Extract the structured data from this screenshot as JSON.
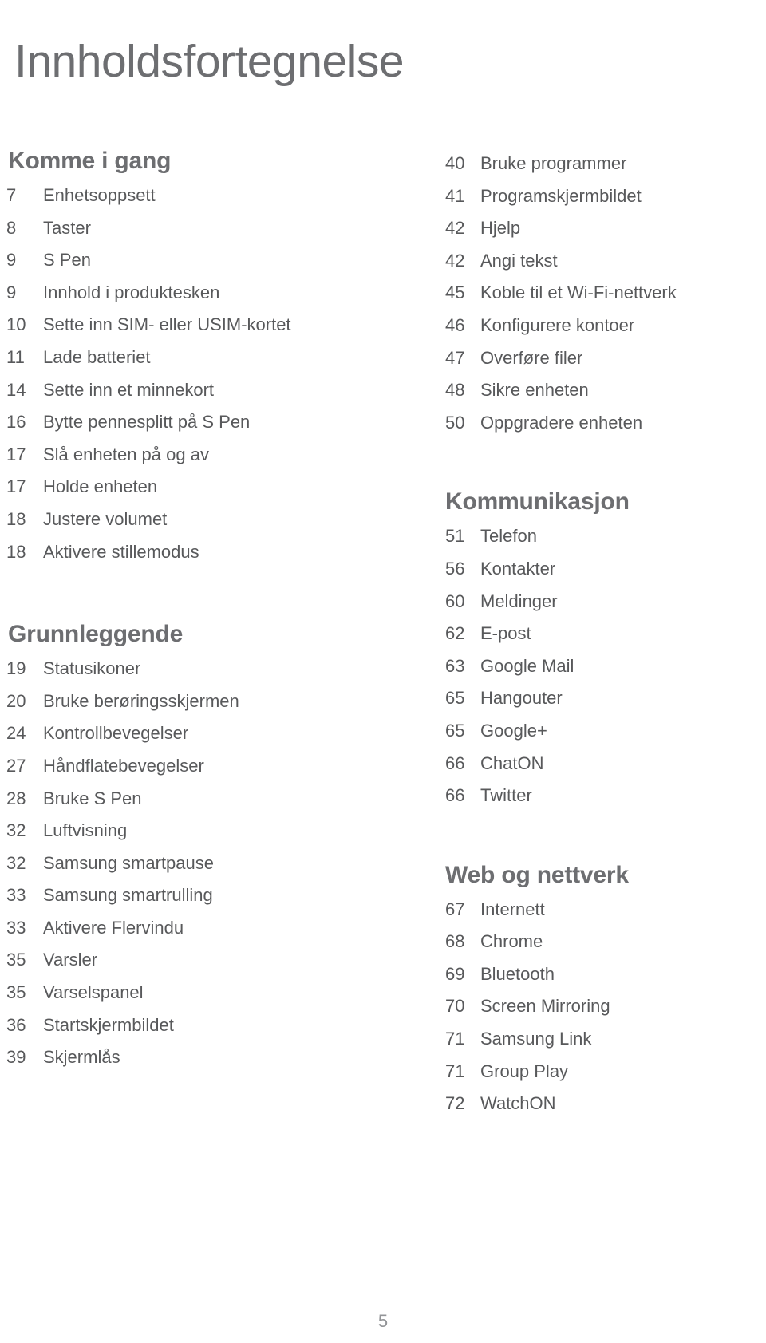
{
  "document": {
    "title": "Innholdsfortegnelse",
    "page_number": "5"
  },
  "left_column": {
    "sections": [
      {
        "title": "Komme i gang",
        "entries": [
          {
            "page": "7",
            "label": "Enhetsoppsett"
          },
          {
            "page": "8",
            "label": "Taster"
          },
          {
            "page": "9",
            "label": "S Pen"
          },
          {
            "page": "9",
            "label": "Innhold i produktesken"
          },
          {
            "page": "10",
            "label": "Sette inn SIM- eller USIM-kortet"
          },
          {
            "page": "11",
            "label": "Lade batteriet"
          },
          {
            "page": "14",
            "label": "Sette inn et minnekort"
          },
          {
            "page": "16",
            "label": "Bytte pennesplitt på S Pen"
          },
          {
            "page": "17",
            "label": "Slå enheten på og av"
          },
          {
            "page": "17",
            "label": "Holde enheten"
          },
          {
            "page": "18",
            "label": "Justere volumet"
          },
          {
            "page": "18",
            "label": "Aktivere stillemodus"
          }
        ]
      },
      {
        "title": "Grunnleggende",
        "entries": [
          {
            "page": "19",
            "label": "Statusikoner"
          },
          {
            "page": "20",
            "label": "Bruke berøringsskjermen"
          },
          {
            "page": "24",
            "label": "Kontrollbevegelser"
          },
          {
            "page": "27",
            "label": "Håndflatebevegelser"
          },
          {
            "page": "28",
            "label": "Bruke S Pen"
          },
          {
            "page": "32",
            "label": "Luftvisning"
          },
          {
            "page": "32",
            "label": "Samsung smartpause"
          },
          {
            "page": "33",
            "label": "Samsung smartrulling"
          },
          {
            "page": "33",
            "label": "Aktivere Flervindu"
          },
          {
            "page": "35",
            "label": "Varsler"
          },
          {
            "page": "35",
            "label": "Varselspanel"
          },
          {
            "page": "36",
            "label": "Startskjermbildet"
          },
          {
            "page": "39",
            "label": "Skjermlås"
          }
        ]
      }
    ]
  },
  "right_column": {
    "sections": [
      {
        "title": "",
        "entries": [
          {
            "page": "40",
            "label": "Bruke programmer"
          },
          {
            "page": "41",
            "label": "Programskjermbildet"
          },
          {
            "page": "42",
            "label": "Hjelp"
          },
          {
            "page": "42",
            "label": "Angi tekst"
          },
          {
            "page": "45",
            "label": "Koble til et Wi-Fi-nettverk"
          },
          {
            "page": "46",
            "label": "Konfigurere kontoer"
          },
          {
            "page": "47",
            "label": "Overføre filer"
          },
          {
            "page": "48",
            "label": "Sikre enheten"
          },
          {
            "page": "50",
            "label": "Oppgradere enheten"
          }
        ]
      },
      {
        "title": "Kommunikasjon",
        "entries": [
          {
            "page": "51",
            "label": "Telefon"
          },
          {
            "page": "56",
            "label": "Kontakter"
          },
          {
            "page": "60",
            "label": "Meldinger"
          },
          {
            "page": "62",
            "label": "E-post"
          },
          {
            "page": "63",
            "label": "Google Mail"
          },
          {
            "page": "65",
            "label": "Hangouter"
          },
          {
            "page": "65",
            "label": "Google+"
          },
          {
            "page": "66",
            "label": "ChatON"
          },
          {
            "page": "66",
            "label": "Twitter"
          }
        ]
      },
      {
        "title": "Web og nettverk",
        "entries": [
          {
            "page": "67",
            "label": "Internett"
          },
          {
            "page": "68",
            "label": "Chrome"
          },
          {
            "page": "69",
            "label": "Bluetooth"
          },
          {
            "page": "70",
            "label": "Screen Mirroring"
          },
          {
            "page": "71",
            "label": "Samsung Link"
          },
          {
            "page": "71",
            "label": "Group Play"
          },
          {
            "page": "72",
            "label": "WatchON"
          }
        ]
      }
    ]
  }
}
